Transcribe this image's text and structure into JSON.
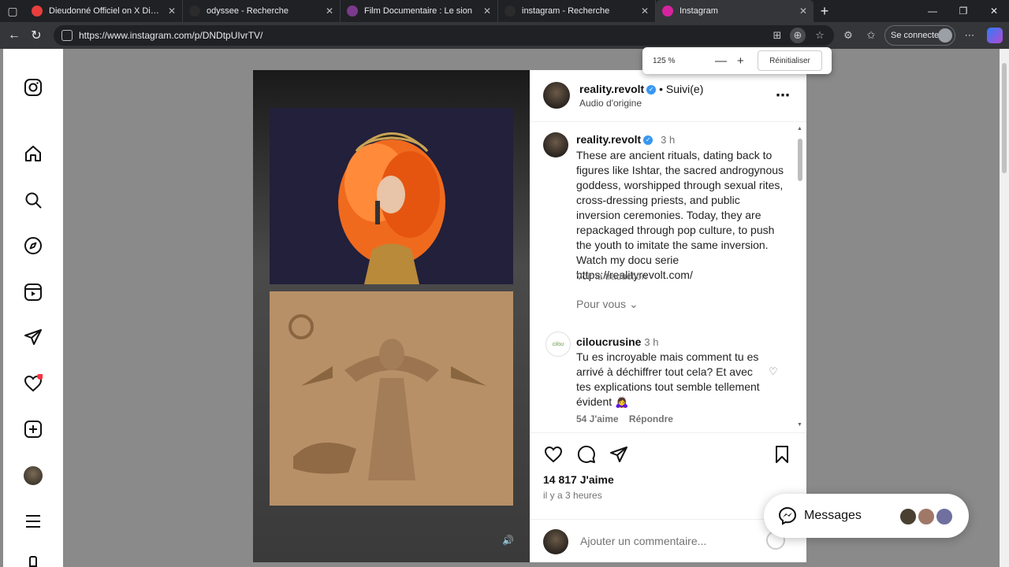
{
  "browser": {
    "tabs": [
      {
        "title": "Dieudonné Officiel on X Dieudonn",
        "favicon_color": "#e83e3e",
        "active": false
      },
      {
        "title": "odyssee - Recherche",
        "favicon_color": "#2b2b2b",
        "active": false
      },
      {
        "title": "Film Documentaire : Le sion",
        "favicon_color": "#7b3a8c",
        "active": false
      },
      {
        "title": "instagram - Recherche",
        "favicon_color": "#2b2b2b",
        "active": false
      },
      {
        "title": "Instagram",
        "favicon_color": "#d6249f",
        "active": true
      }
    ],
    "url": "https://www.instagram.com/p/DNDtpUIvrTV/",
    "signin_label": "Se connecter",
    "zoom": {
      "value": "125 %",
      "reset_label": "Réinitialiser"
    }
  },
  "post": {
    "header": {
      "username": "reality.revolt",
      "follow_status": "Suivi(e)",
      "audio": "Audio d'origine"
    },
    "caption": {
      "username": "reality.revolt",
      "time": "3 h",
      "text": "These are ancient rituals, dating back to figures like Ishtar, the sacred androgynous goddess, worshipped through sexual rites, cross-dressing priests, and public inversion ceremonies. Today, they are repackaged through pop culture, to push the youth to imitate the same inversion. Watch my docu serie https://realityrevolt.com/",
      "translate": "Voir la traduction"
    },
    "for_you": "Pour vous",
    "comments": [
      {
        "username": "ciloucrusine",
        "time": "3 h",
        "text": "Tu es incroyable mais comment tu es arrivé à déchiffrer tout cela? Et avec tes explications tout semble tellement évident 🙇‍♀️",
        "likes": "54 J'aime",
        "reply": "Répondre"
      }
    ],
    "likes_count": "14 817 J'aime",
    "posted_ago": "il y a 3 heures",
    "comment_placeholder": "Ajouter un commentaire..."
  },
  "messages": {
    "label": "Messages"
  },
  "colors": {
    "accent": "#3897f0",
    "notification": "#ff3040"
  }
}
